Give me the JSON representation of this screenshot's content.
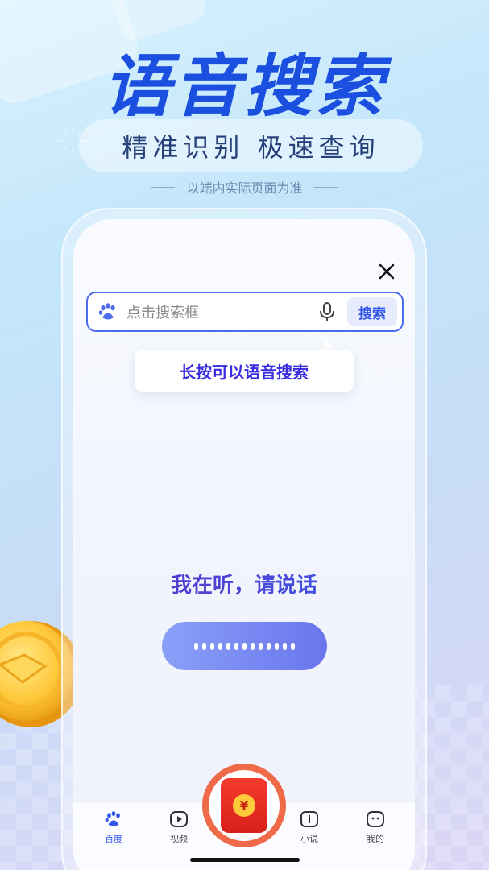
{
  "promo": {
    "headline": "语音搜索",
    "subtitle": "精准识别  极速查询",
    "note": "以端内实际页面为准"
  },
  "screen": {
    "search": {
      "placeholder": "点击搜索框",
      "button_label": "搜索"
    },
    "tooltip": "长按可以语音搜索",
    "listening_text": "我在听，请说话",
    "close_icon": "close-icon",
    "nav": {
      "items": [
        {
          "label": "百度",
          "icon": "baidu-paw-icon",
          "active": true
        },
        {
          "label": "视频",
          "icon": "play-icon",
          "active": false
        },
        {
          "label": "小说",
          "icon": "book-icon",
          "active": false
        },
        {
          "label": "我的",
          "icon": "profile-icon",
          "active": false
        }
      ],
      "center": {
        "icon": "red-envelope-icon",
        "symbol": "¥"
      }
    }
  },
  "colors": {
    "accent": "#3456e8",
    "headline": "#1a4fe0",
    "red_envelope": "#e32a20"
  }
}
